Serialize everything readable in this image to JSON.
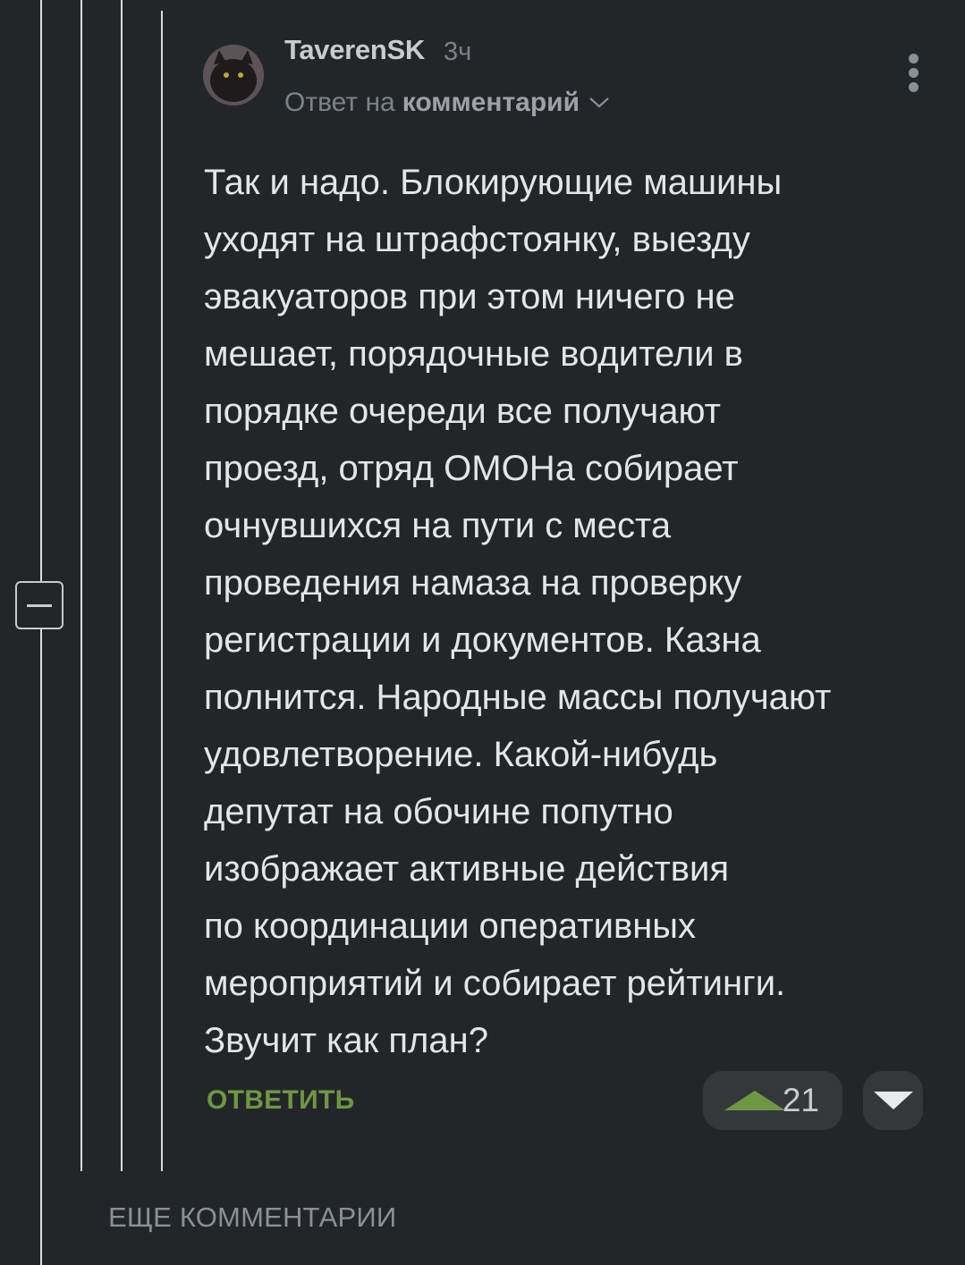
{
  "comment": {
    "author": "TaverenSK",
    "time_ago": "3ч",
    "reply_prefix": "Ответ на",
    "reply_target": "комментарий",
    "text": "Так и надо. Блокирующие машины\nуходят на штрафстоянку, выезду\nэвакуаторов при этом ничего не\nмешает, порядочные водители в\nпорядке очереди все получают\nпроезд, отряд ОМОНа собирает\nочнувшихся на пути с места\nпроведения намаза на проверку\nрегистрации и документов. Казна\nполнится. Народные массы получают\nудовлетворение. Какой-нибудь\nдепутат на обочине попутно\nизображает активные действия\nпо координации оперативных\nмероприятий и собирает рейтинги.\nЗвучит как план?",
    "reply_label": "ОТВЕТИТЬ",
    "rating": "21"
  },
  "footer": {
    "more_comments_label": "ЕЩЕ КОММЕНТАРИИ"
  },
  "icons": {
    "collapse": "minus-square-icon",
    "more": "more-vertical-icon",
    "reply_dropdown": "chevron-down-icon",
    "upvote": "triangle-up-icon",
    "downvote": "triangle-down-icon"
  },
  "colors": {
    "background": "#232629",
    "accent_green": "#6e9743",
    "text": "#e3e5e7",
    "muted": "#7d8286"
  }
}
